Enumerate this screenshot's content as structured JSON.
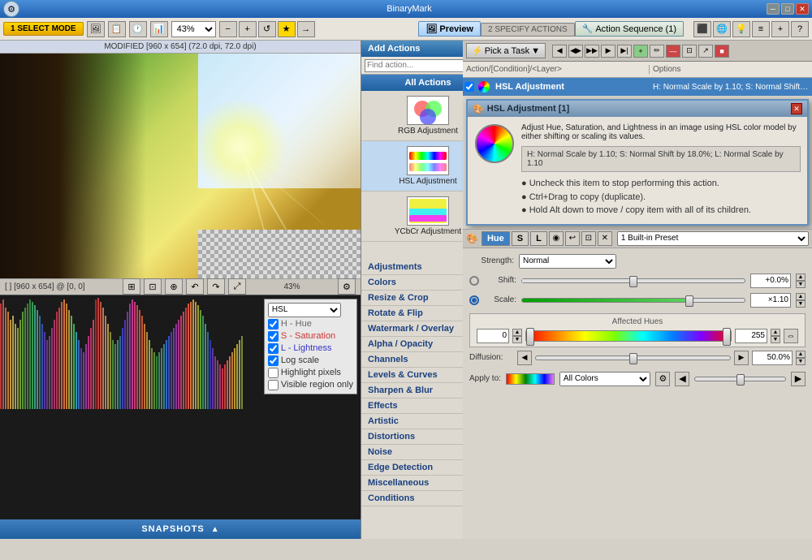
{
  "app": {
    "title": "BinaryMark",
    "window_controls": {
      "minimize": "─",
      "maximize": "□",
      "close": "✕"
    }
  },
  "toolbar1": {
    "mode_btn": "1 SELECT MODE",
    "zoom_value": "43%",
    "tab_preview": "Preview",
    "tab_specify": "2 SPECIFY ACTIONS",
    "tab_sequence": "Action Sequence (1)"
  },
  "image": {
    "title": "MODIFIED [960 x 654] (72.0 dpi, 72.0 dpi)",
    "status_left": "[ ] [960 x 654] @ [0, 0]",
    "status_zoom": "43%"
  },
  "histogram": {
    "channel": "HSL",
    "channels": [
      {
        "label": "H - Hue",
        "color": "#888888",
        "checked": true
      },
      {
        "label": "S - Saturation",
        "color": "#cc3333",
        "checked": true
      },
      {
        "label": "L - Lightness",
        "color": "#5555cc",
        "checked": true
      }
    ],
    "options": [
      "Log scale",
      "Highlight pixels",
      "Visible region only"
    ]
  },
  "add_actions": {
    "header": "Add Actions",
    "chevron": "«",
    "find_placeholder": "Find action...",
    "all_actions_tab": "All Actions",
    "actions": [
      {
        "name": "RGB Adjustment",
        "thumb_color": "#e8a0a0"
      },
      {
        "name": "HSL Adjustment",
        "thumb_color": "#a0c0e8"
      },
      {
        "name": "YCbCr Adjustment",
        "thumb_color": "#a0e8b0"
      }
    ],
    "categories": [
      "Adjustments",
      "Colors",
      "Resize & Crop",
      "Rotate & Flip",
      "Watermark / Overlay",
      "Alpha / Opacity",
      "Channels",
      "Levels & Curves",
      "Sharpen & Blur",
      "Effects",
      "Artistic",
      "Distortions",
      "Noise",
      "Edge Detection",
      "Miscellaneous",
      "Conditions"
    ]
  },
  "sequence": {
    "pick_task": "Pick a Task",
    "col_action": "Action/[Condition]/<Layer>",
    "col_options": "Options",
    "row": {
      "checked": true,
      "name": "HSL Adjustment",
      "options": "H: Normal Scale by 1.10; S: Normal Shift by..."
    }
  },
  "hsl_popup": {
    "title": "HSL Adjustment [1]",
    "description": "Adjust Hue, Saturation, and Lightness in an image using HSL color model by either shifting or scaling its values.",
    "params": "H: Normal Scale by 1.10; S: Normal Shift by 18.0%; L: Normal Scale by 1.10",
    "tips": [
      "Uncheck this item to stop performing this action.",
      "Ctrl+Drag to copy (duplicate).",
      "Hold Alt down to move / copy item with all of its children."
    ]
  },
  "hsl_editor": {
    "tabs": [
      "Hue",
      "S",
      "L"
    ],
    "icons": [
      "◉",
      "↩",
      "⊡",
      "✕"
    ],
    "preset": "1 Built-in Preset",
    "strength_label": "Strength:",
    "strength_value": "Normal",
    "shift_label": "Shift:",
    "shift_value": "+0.0%",
    "scale_label": "Scale:",
    "scale_value": "×1.10",
    "affected_hues_title": "Affected Hues",
    "hue_start": "0",
    "hue_end": "255",
    "diffusion_label": "Diffusion:",
    "diffusion_value": "50.0%",
    "apply_label": "Apply to:",
    "apply_value": "All Colors"
  },
  "snapshots": {
    "label": "SNAPSHOTS",
    "arrow": "▲"
  }
}
